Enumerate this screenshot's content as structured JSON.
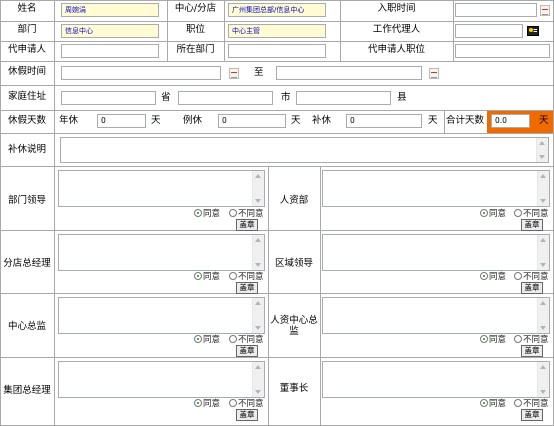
{
  "form": {
    "name_label": "姓名",
    "name_value": "周婉涓",
    "center_label": "中心/分店",
    "center_value": "广州集团总部/信息中心",
    "hire_label": "入职时间",
    "dept_label": "部门",
    "dept_value": "信息中心",
    "position_label": "职位",
    "position_value": "中心主管",
    "agent_label": "工作代理人",
    "proxy_label": "代申请人",
    "proxy_dept_label": "所在部门",
    "proxy_pos_label": "代申请人职位",
    "leave_time_label": "休假时间",
    "to_label": "至",
    "address_label": "家庭住址",
    "province_label": "省",
    "city_label": "市",
    "county_label": "县",
    "days_label": "休假天数",
    "annual_label": "年休",
    "annual_value": "0",
    "routine_label": "例休",
    "routine_value": "0",
    "comp_label": "补休",
    "comp_value": "0",
    "day_unit": "天",
    "total_label": "合计天数",
    "total_value": "0.0",
    "comp_note_label": "补休说明"
  },
  "approvals": {
    "agree": "同意",
    "disagree": "不同意",
    "stamp": "盖章",
    "dept_leader": "部门领导",
    "hr_dept": "人资部",
    "branch_gm": "分店总经理",
    "region_leader": "区域领导",
    "center_director": "中心总监",
    "hr_center_director": "人资中心总监",
    "group_gm": "集团总经理",
    "chairman": "董事长"
  },
  "colors": {
    "total_bg": "#f06a00",
    "readonly_bg": "#fffcd3",
    "readonly_text": "#0000cc",
    "grid": "#a9a9a9"
  }
}
